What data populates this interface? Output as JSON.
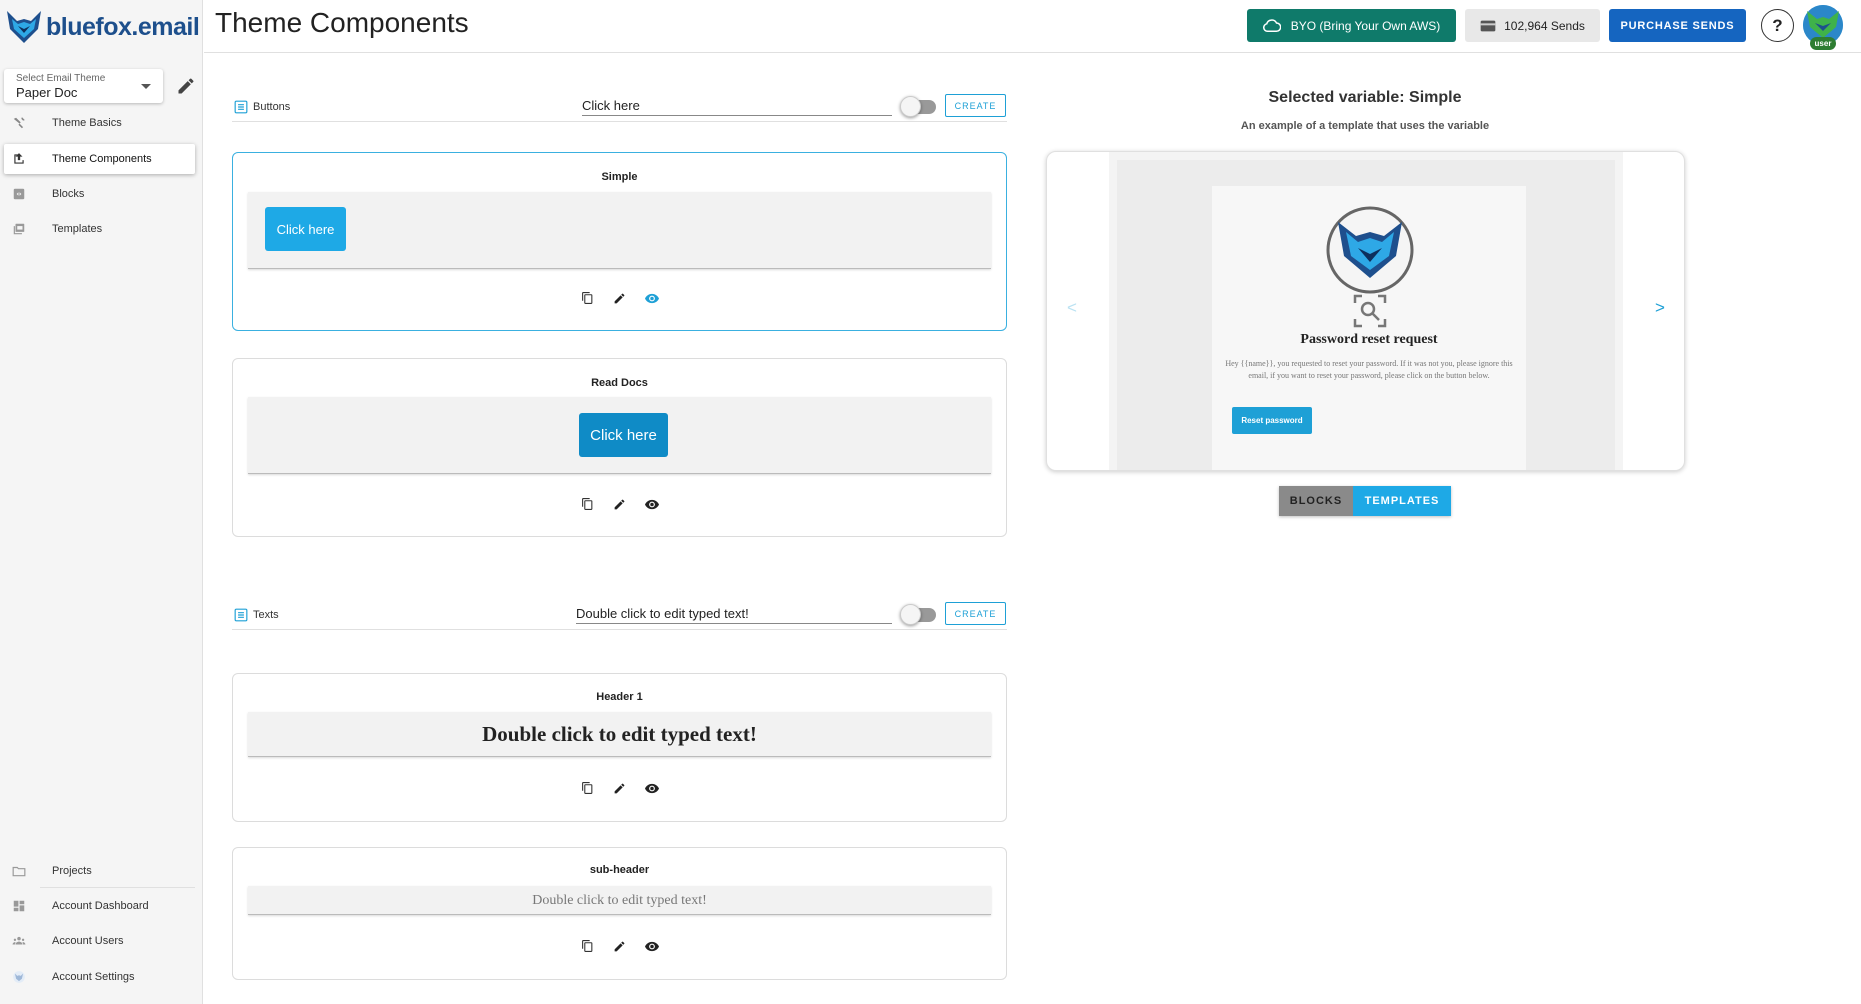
{
  "brand": {
    "logo_text": "bluefox.email",
    "accent": "#1ea9e6",
    "primary": "#1565c0",
    "byo_color": "#0f7a6a"
  },
  "sidebar": {
    "theme_select": {
      "label": "Select Email Theme",
      "value": "Paper Doc"
    },
    "nav_top": [
      {
        "label": "Theme Basics",
        "icon": "tools-icon",
        "active": false
      },
      {
        "label": "Theme Components",
        "icon": "component-icon",
        "active": true
      },
      {
        "label": "Blocks",
        "icon": "blocks-icon",
        "active": false
      },
      {
        "label": "Templates",
        "icon": "templates-icon",
        "active": false
      }
    ],
    "nav_bottom": [
      {
        "label": "Projects",
        "icon": "folder-icon"
      },
      {
        "label": "Account Dashboard",
        "icon": "dashboard-icon"
      },
      {
        "label": "Account Users",
        "icon": "users-icon"
      },
      {
        "label": "Account Settings",
        "icon": "settings-icon"
      }
    ]
  },
  "header": {
    "title": "Theme Components",
    "byo_label": "BYO (Bring Your Own AWS)",
    "sends_label": "102,964 Sends",
    "purchase_label": "PURCHASE SENDS",
    "help_label": "?",
    "avatar_badge": "user"
  },
  "buttons_section": {
    "title": "Buttons",
    "input_value": "Click here",
    "create_label": "CREATE",
    "items": [
      {
        "name": "Simple",
        "button_text": "Click here",
        "selected": true,
        "button_color": "#1ea9e6"
      },
      {
        "name": "Read Docs",
        "button_text": "Click here",
        "selected": false,
        "button_color": "#0f8bc6"
      }
    ]
  },
  "texts_section": {
    "title": "Texts",
    "input_value": "Double click to edit typed text!",
    "create_label": "CREATE",
    "items": [
      {
        "name": "Header 1",
        "text": "Double click to edit typed text!"
      },
      {
        "name": "sub-header",
        "text": "Double click to edit typed text!"
      }
    ]
  },
  "preview": {
    "selected_title": "Selected variable: Simple",
    "subtitle": "An example of a template that uses the variable",
    "prev_arrow": "<",
    "next_arrow": ">",
    "email": {
      "heading": "Password reset request",
      "body": "Hey {{name}}, you requested to reset your password. If it was not you, please ignore this email, if you want to reset your password, please click on the button below.",
      "button": "Reset password"
    },
    "tabs": [
      "BLOCKS",
      "TEMPLATES"
    ],
    "active_tab": "TEMPLATES"
  }
}
